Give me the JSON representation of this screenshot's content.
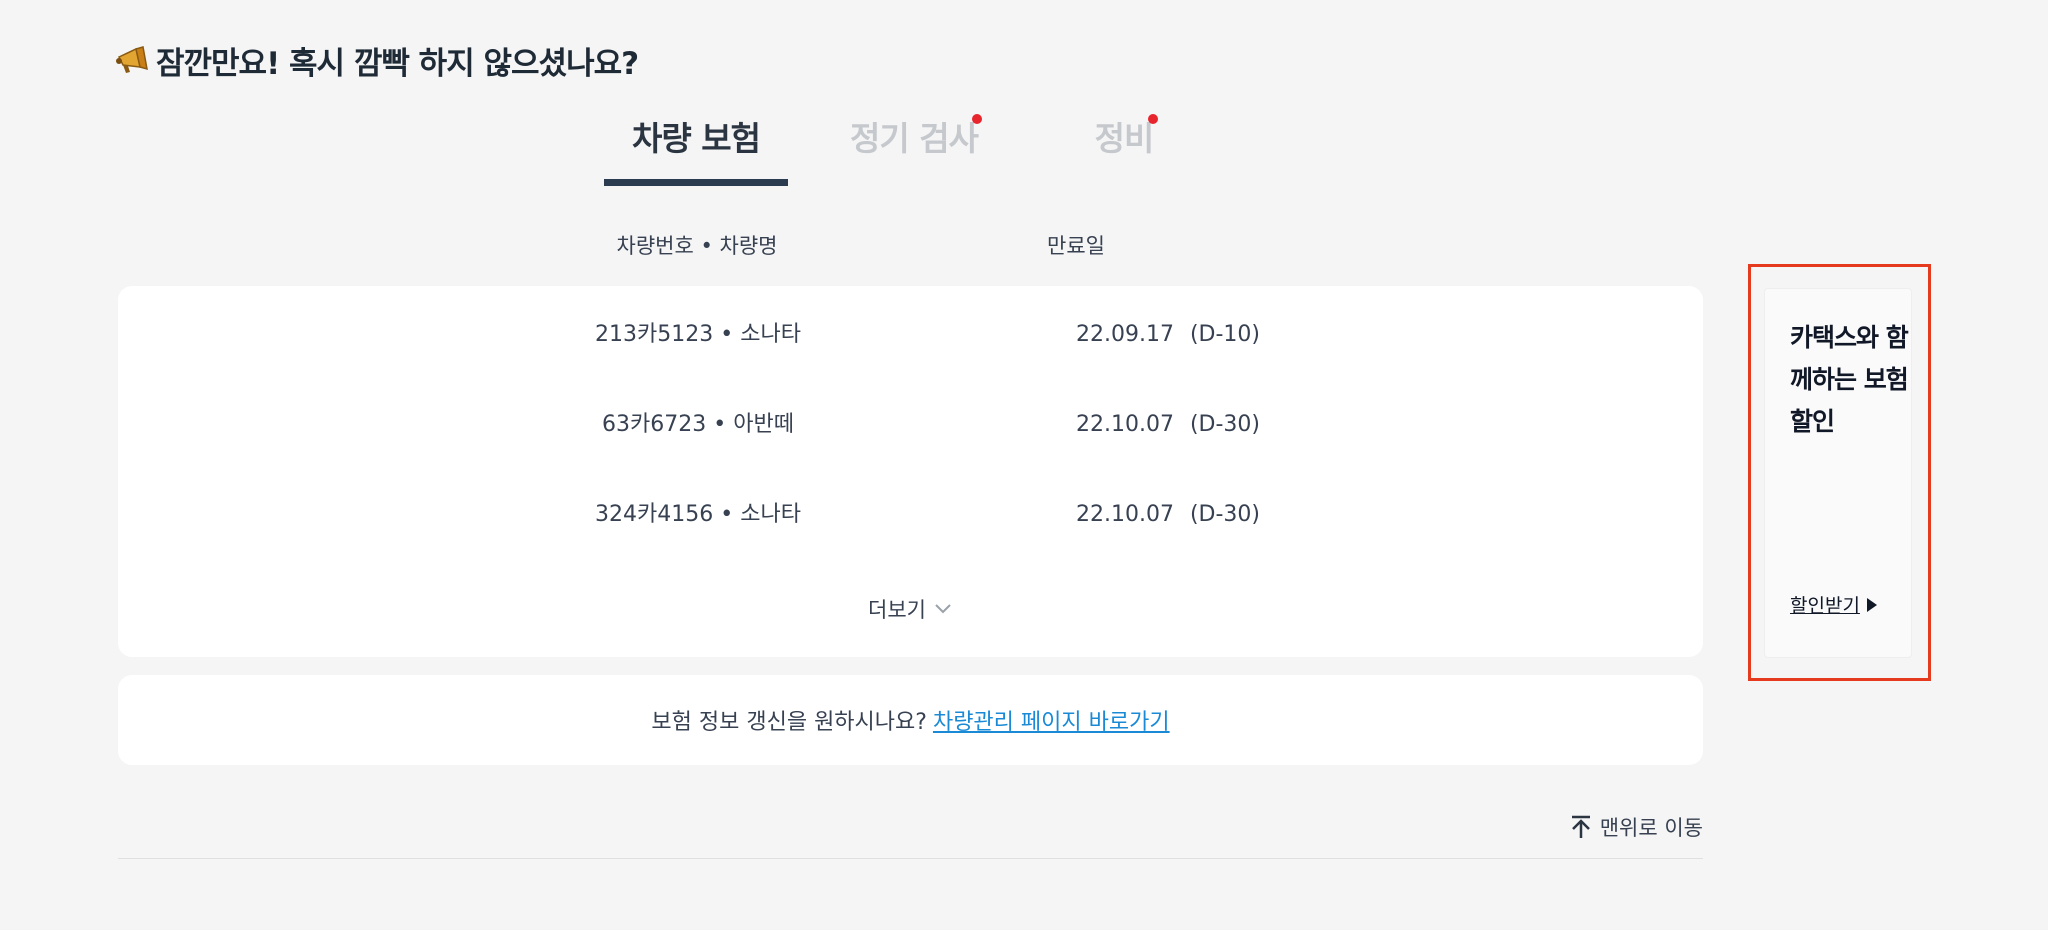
{
  "heading": {
    "title": "잠깐만요! 혹시 깜빡 하지 않으셨나요?",
    "icon": "megaphone-icon"
  },
  "tabs": [
    {
      "label": "차량 보험",
      "active": true,
      "notification": false
    },
    {
      "label": "정기 검사",
      "active": false,
      "notification": true
    },
    {
      "label": "정비",
      "active": false,
      "notification": true
    }
  ],
  "columns": {
    "vehicle": "차량번호 • 차량명",
    "expiry": "만료일"
  },
  "rows": [
    {
      "vehicle": "213카5123 • 소나타",
      "date": "22.09.17",
      "dday": "(D-10)"
    },
    {
      "vehicle": "63카6723 • 아반떼",
      "date": "22.10.07",
      "dday": "(D-30)"
    },
    {
      "vehicle": "324카4156 • 소나타",
      "date": "22.10.07",
      "dday": "(D-30)"
    }
  ],
  "more": {
    "label": "더보기",
    "icon": "chevron-down-icon"
  },
  "info": {
    "text": "보험 정보 갱신을 원하시나요?",
    "link": "차량관리 페이지 바로가기"
  },
  "to_top": {
    "label": "맨위로 이동",
    "icon": "arrow-up-icon"
  },
  "ad": {
    "title": "카택스와 함께하는 보험할인",
    "link": "할인받기",
    "icon": "triangle-right-icon"
  },
  "colors": {
    "background": "#f5f5f5",
    "card": "#ffffff",
    "tab_active": "#2b3542",
    "tab_inactive": "#c5c8cc",
    "underline": "#2b3b50",
    "notification_dot": "#e8242d",
    "link": "#1a8ad6",
    "highlight_frame": "#e63a1f"
  }
}
